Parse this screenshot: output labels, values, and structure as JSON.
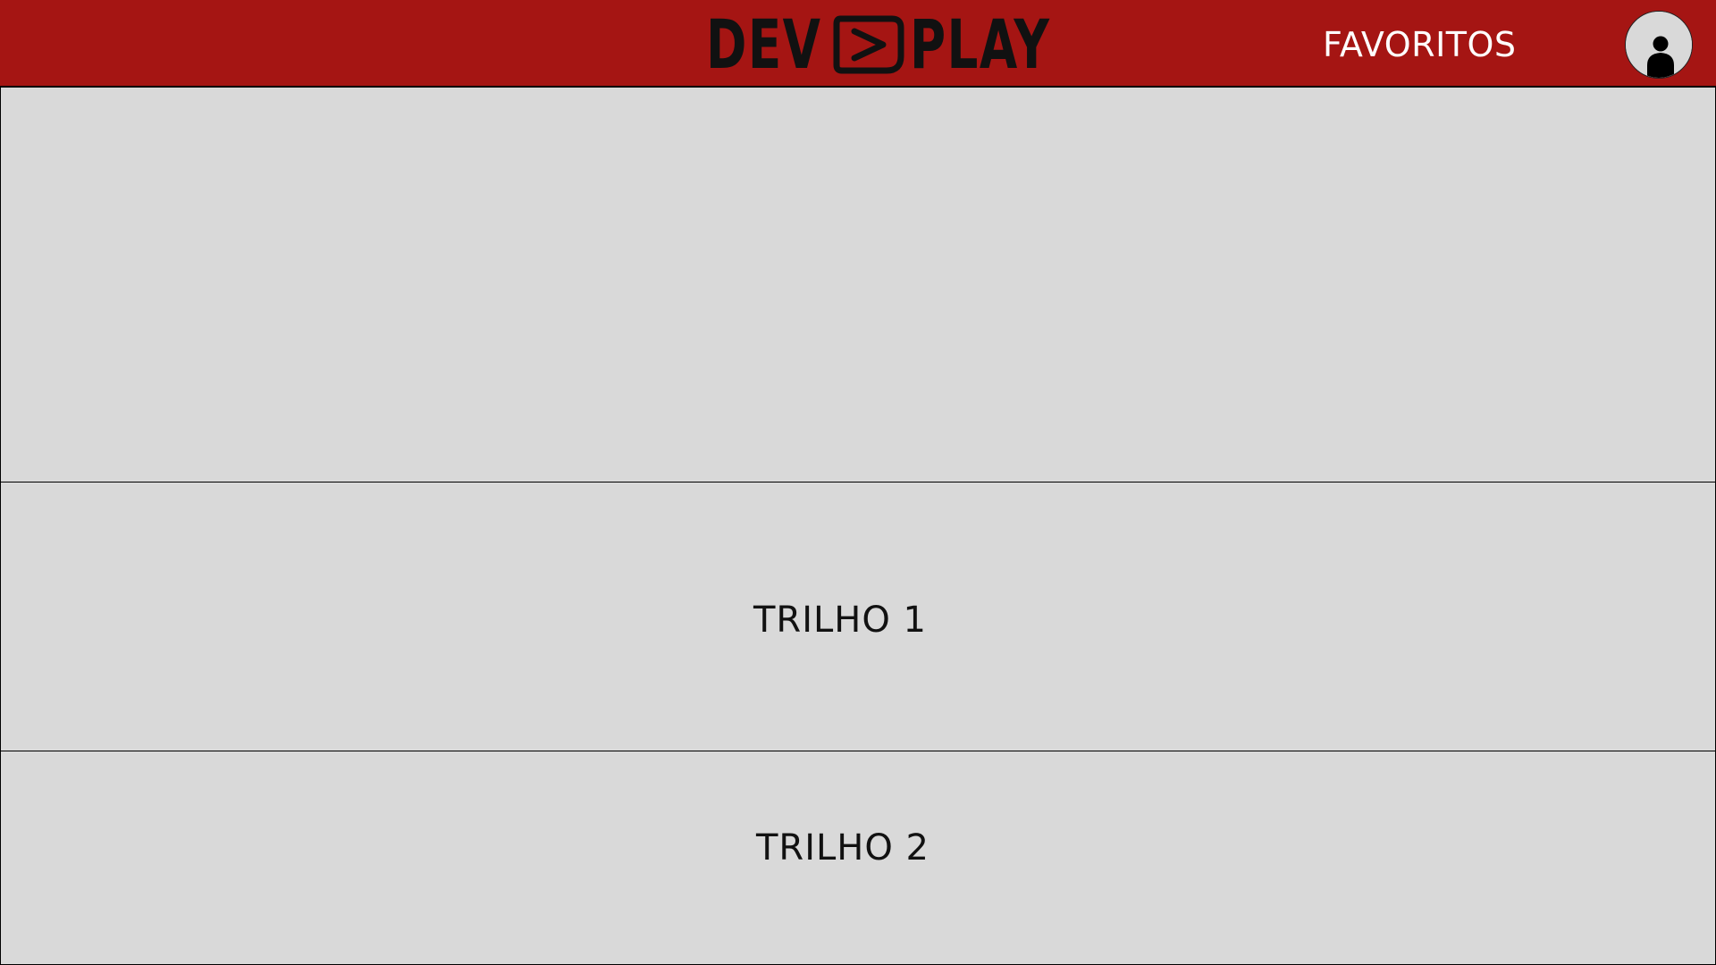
{
  "header": {
    "logo": {
      "left_text": "DEV",
      "right_text": "PLAY",
      "icon": "play-box-icon"
    },
    "favorites_label": "FAVORITOS",
    "avatar_icon": "user-avatar-icon",
    "background_color": "#a51513"
  },
  "main": {
    "tracks": [
      {
        "label": "TRILHO 1"
      },
      {
        "label": "TRILHO 2"
      }
    ]
  },
  "colors": {
    "page_background": "#d9d9d9",
    "border": "#000000",
    "header_text": "#ffffff",
    "logo": "#111111"
  }
}
